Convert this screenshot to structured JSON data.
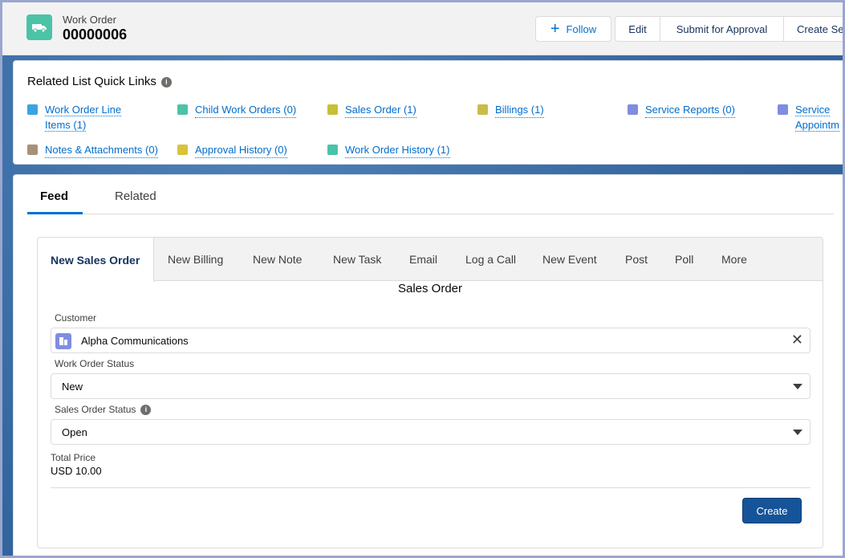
{
  "header": {
    "object_label": "Work Order",
    "record_title": "00000006",
    "object_icon": "work-order-van-icon",
    "icon_color": "#4bc3a6",
    "buttons": {
      "follow": "Follow",
      "edit": "Edit",
      "submit": "Submit for Approval",
      "create": "Create Se"
    }
  },
  "quick_links": {
    "title": "Related List Quick Links",
    "items": [
      {
        "label_line1": "Work Order Line",
        "label_line2": "Items (1)",
        "icon_color": "#3ba3e0"
      },
      {
        "label": "Child Work Orders (0)",
        "icon_color": "#4bc3a6"
      },
      {
        "label": "Sales Order (1)",
        "icon_color": "#c6c03a"
      },
      {
        "label": "Billings (1)",
        "icon_color": "#c9bd48"
      },
      {
        "label": "Service Reports (0)",
        "icon_color": "#7f8de1"
      },
      {
        "label_line1": "Service",
        "label_line2": "Appointm",
        "icon_color": "#7f8de1"
      },
      {
        "label": "Notes & Attachments (0)",
        "icon_color": "#a8917a"
      },
      {
        "label": "Approval History (0)",
        "icon_color": "#d9c33c"
      },
      {
        "label": "Work Order History (1)",
        "icon_color": "#4bc3a6"
      }
    ]
  },
  "feed": {
    "tabs": [
      "Feed",
      "Related"
    ],
    "active_tab": "Feed",
    "publisher_tabs": [
      "New Sales Order",
      "New Billing",
      "New Note",
      "New Task",
      "Email",
      "Log a Call",
      "New Event",
      "Post",
      "Poll",
      "More"
    ],
    "form": {
      "title": "Sales Order",
      "customer_label": "Customer",
      "customer_value": "Alpha Communications",
      "wo_status_label": "Work Order Status",
      "wo_status_value": "New",
      "so_status_label": "Sales Order Status",
      "so_status_value": "Open",
      "total_label": "Total Price",
      "total_value": "USD 10.00",
      "create_label": "Create"
    }
  },
  "colors": {
    "brand": "#0070d2",
    "primary_button": "#16549a"
  }
}
